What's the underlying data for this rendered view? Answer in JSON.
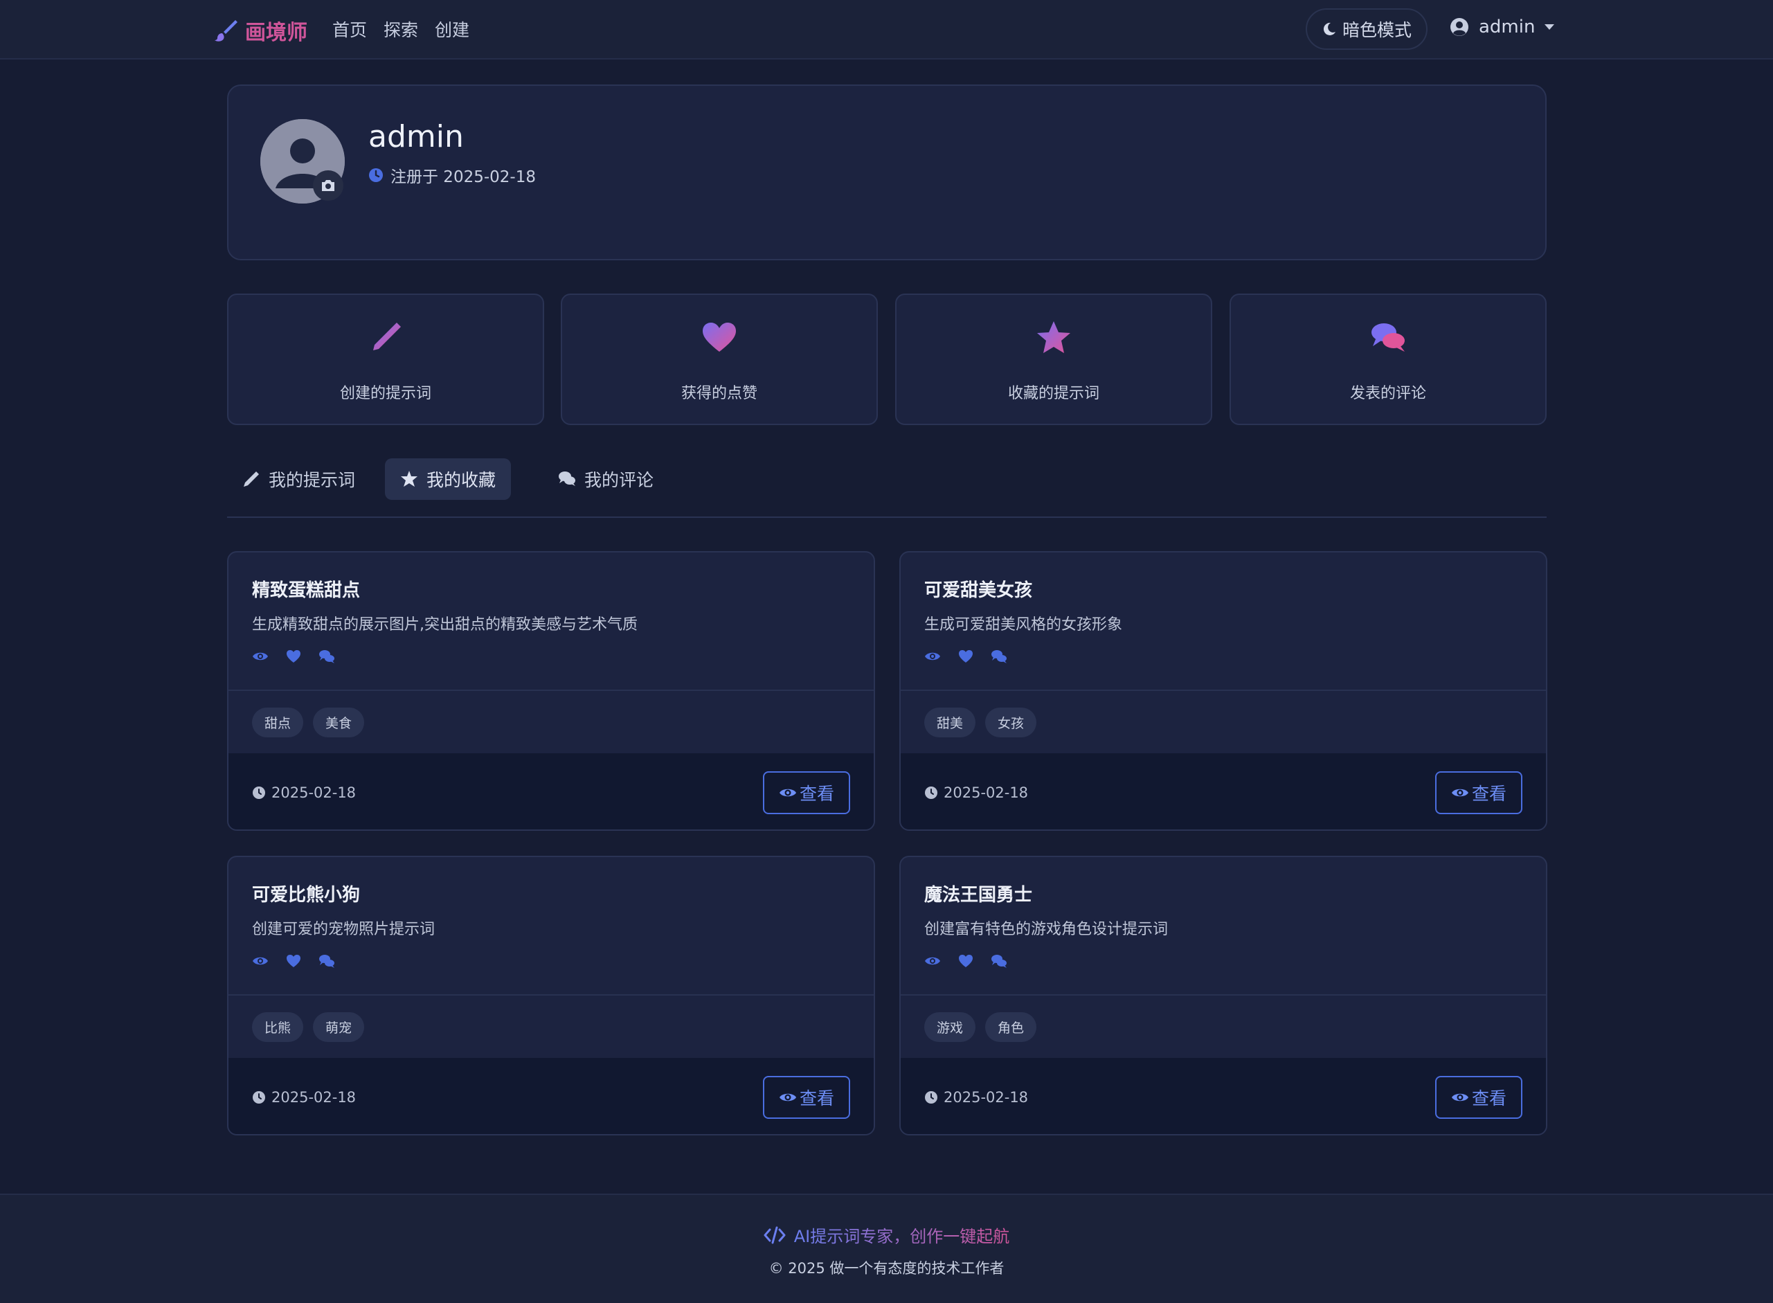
{
  "nav": {
    "brand": "画境师",
    "links": [
      "首页",
      "探索",
      "创建"
    ],
    "theme_label": "暗色模式",
    "user": "admin"
  },
  "profile": {
    "name": "admin",
    "registered": "注册于 2025-02-18"
  },
  "stats": [
    {
      "label": "创建的提示词",
      "icon": "pencil-icon"
    },
    {
      "label": "获得的点赞",
      "icon": "heart-icon"
    },
    {
      "label": "收藏的提示词",
      "icon": "star-icon"
    },
    {
      "label": "发表的评论",
      "icon": "comments-icon"
    }
  ],
  "tabs": [
    {
      "label": "我的提示词",
      "icon": "pencil-icon",
      "active": false
    },
    {
      "label": "我的收藏",
      "icon": "star-icon",
      "active": true
    },
    {
      "label": "我的评论",
      "icon": "comments-icon",
      "active": false
    }
  ],
  "prompts": [
    {
      "title": "精致蛋糕甜点",
      "desc": "生成精致甜点的展示图片,突出甜点的精致美感与艺术气质",
      "tags": [
        "甜点",
        "美食"
      ],
      "date": "2025-02-18",
      "view_label": "查看"
    },
    {
      "title": "可爱甜美女孩",
      "desc": "生成可爱甜美风格的女孩形象",
      "tags": [
        "甜美",
        "女孩"
      ],
      "date": "2025-02-18",
      "view_label": "查看"
    },
    {
      "title": "可爱比熊小狗",
      "desc": "创建可爱的宠物照片提示词",
      "tags": [
        "比熊",
        "萌宠"
      ],
      "date": "2025-02-18",
      "view_label": "查看"
    },
    {
      "title": "魔法王国勇士",
      "desc": "创建富有特色的游戏角色设计提示词",
      "tags": [
        "游戏",
        "角色"
      ],
      "date": "2025-02-18",
      "view_label": "查看"
    }
  ],
  "footer": {
    "tagline": "AI提示词专家，创作一键起航",
    "copyright": "© 2025 做一个有态度的技术工作者"
  },
  "colors": {
    "background": "#161c33",
    "card": "#1c2340",
    "accent_blue": "#4a6de0",
    "accent_pink": "#d0559a"
  }
}
